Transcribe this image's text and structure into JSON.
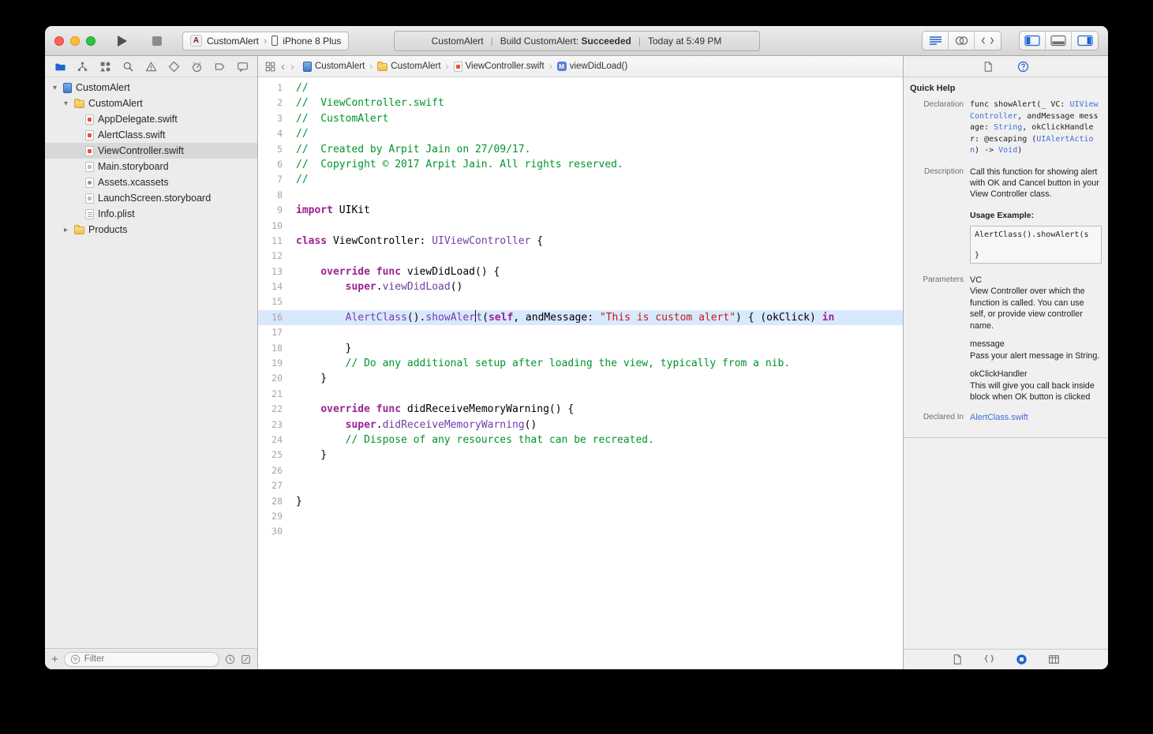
{
  "colors": {
    "accent": "#1B66D2",
    "keyword": "#9B2393",
    "type": "#703DAA",
    "string": "#C41A16",
    "comment": "#00942A",
    "link": "#3E6FD6",
    "current_line_band": "#D9E9FD"
  },
  "toolbar": {
    "app_icon_glyph": "A",
    "scheme": "CustomAlert",
    "scheme_chevron": "›",
    "device": "iPhone 8 Plus",
    "status": {
      "project": "CustomAlert",
      "separator": "|",
      "action": "Build CustomAlert:",
      "result": "Succeeded",
      "time": "Today at 5:49 PM"
    },
    "editor_modes": [
      "standard-editor",
      "assistant-editor",
      "version-editor"
    ],
    "active_editor_mode": "standard-editor",
    "panel_toggles": [
      {
        "id": "navigator-panel",
        "active": true
      },
      {
        "id": "debug-panel",
        "active": false
      },
      {
        "id": "inspector-panel",
        "active": true
      }
    ]
  },
  "navigator": {
    "tabs": [
      "project",
      "source-control",
      "symbols",
      "find",
      "issues",
      "tests",
      "debug",
      "breakpoints",
      "reports"
    ],
    "active_tab": "project",
    "tree": [
      {
        "label": "CustomAlert",
        "icon": "project",
        "level": 0,
        "disclosure": "open"
      },
      {
        "label": "CustomAlert",
        "icon": "folder",
        "level": 1,
        "disclosure": "open"
      },
      {
        "label": "AppDelegate.swift",
        "icon": "swift",
        "level": 2
      },
      {
        "label": "AlertClass.swift",
        "icon": "swift",
        "level": 2
      },
      {
        "label": "ViewController.swift",
        "icon": "swift",
        "level": 2,
        "selected": true
      },
      {
        "label": "Main.storyboard",
        "icon": "storyboard",
        "level": 2
      },
      {
        "label": "Assets.xcassets",
        "icon": "assets",
        "level": 2
      },
      {
        "label": "LaunchScreen.storyboard",
        "icon": "storyboard",
        "level": 2
      },
      {
        "label": "Info.plist",
        "icon": "plist",
        "level": 2
      },
      {
        "label": "Products",
        "icon": "folder",
        "level": 1,
        "disclosure": "closed"
      }
    ],
    "filter": {
      "placeholder": "Filter"
    }
  },
  "jumpbar": {
    "crumbs": [
      {
        "label": "CustomAlert",
        "icon": "file-blue"
      },
      {
        "label": "CustomAlert",
        "icon": "folder"
      },
      {
        "label": "ViewController.swift",
        "icon": "swift"
      },
      {
        "label": "viewDidLoad()",
        "icon": "method-badge"
      }
    ]
  },
  "editor": {
    "current_line": 16,
    "lines": [
      {
        "n": 1,
        "seg": [
          [
            "cm",
            "//"
          ]
        ]
      },
      {
        "n": 2,
        "seg": [
          [
            "cm",
            "//  ViewController.swift"
          ]
        ]
      },
      {
        "n": 3,
        "seg": [
          [
            "cm",
            "//  CustomAlert"
          ]
        ]
      },
      {
        "n": 4,
        "seg": [
          [
            "cm",
            "//"
          ]
        ]
      },
      {
        "n": 5,
        "seg": [
          [
            "cm",
            "//  Created by Arpit Jain on 27/09/17."
          ]
        ]
      },
      {
        "n": 6,
        "seg": [
          [
            "cm",
            "//  Copyright © 2017 Arpit Jain. All rights reserved."
          ]
        ]
      },
      {
        "n": 7,
        "seg": [
          [
            "cm",
            "//"
          ]
        ]
      },
      {
        "n": 8,
        "seg": []
      },
      {
        "n": 9,
        "seg": [
          [
            "kw",
            "import"
          ],
          [
            "pl",
            " UIKit"
          ]
        ]
      },
      {
        "n": 10,
        "seg": []
      },
      {
        "n": 11,
        "seg": [
          [
            "kw",
            "class"
          ],
          [
            "pl",
            " ViewController: "
          ],
          [
            "ty",
            "UIViewController"
          ],
          [
            "pl",
            " {"
          ]
        ]
      },
      {
        "n": 12,
        "seg": []
      },
      {
        "n": 13,
        "seg": [
          [
            "pl",
            "    "
          ],
          [
            "kw",
            "override"
          ],
          [
            "pl",
            " "
          ],
          [
            "kw",
            "func"
          ],
          [
            "pl",
            " viewDidLoad() {"
          ]
        ]
      },
      {
        "n": 14,
        "seg": [
          [
            "pl",
            "        "
          ],
          [
            "kw",
            "super"
          ],
          [
            "pl",
            "."
          ],
          [
            "ty",
            "viewDidLoad"
          ],
          [
            "pl",
            "()"
          ]
        ]
      },
      {
        "n": 15,
        "seg": []
      },
      {
        "n": 16,
        "seg": [
          [
            "pl",
            "        "
          ],
          [
            "ty",
            "AlertClass"
          ],
          [
            "pl",
            "()."
          ],
          [
            "ty",
            "showAler"
          ],
          [
            "caret",
            ""
          ],
          [
            "ty",
            "t"
          ],
          [
            "pl",
            "("
          ],
          [
            "kw",
            "self"
          ],
          [
            "pl",
            ", andMessage: "
          ],
          [
            "st",
            "\"This is custom alert\""
          ],
          [
            "pl",
            ") { (okClick) "
          ],
          [
            "kw",
            "in"
          ]
        ]
      },
      {
        "n": 17,
        "seg": []
      },
      {
        "n": 18,
        "seg": [
          [
            "pl",
            "        }"
          ]
        ]
      },
      {
        "n": 19,
        "seg": [
          [
            "pl",
            "        "
          ],
          [
            "cm",
            "// Do any additional setup after loading the view, typically from a nib."
          ]
        ]
      },
      {
        "n": 20,
        "seg": [
          [
            "pl",
            "    }"
          ]
        ]
      },
      {
        "n": 21,
        "seg": []
      },
      {
        "n": 22,
        "seg": [
          [
            "pl",
            "    "
          ],
          [
            "kw",
            "override"
          ],
          [
            "pl",
            " "
          ],
          [
            "kw",
            "func"
          ],
          [
            "pl",
            " didReceiveMemoryWarning() {"
          ]
        ]
      },
      {
        "n": 23,
        "seg": [
          [
            "pl",
            "        "
          ],
          [
            "kw",
            "super"
          ],
          [
            "pl",
            "."
          ],
          [
            "ty",
            "didReceiveMemoryWarning"
          ],
          [
            "pl",
            "()"
          ]
        ]
      },
      {
        "n": 24,
        "seg": [
          [
            "pl",
            "        "
          ],
          [
            "cm",
            "// Dispose of any resources that can be recreated."
          ]
        ]
      },
      {
        "n": 25,
        "seg": [
          [
            "pl",
            "    }"
          ]
        ]
      },
      {
        "n": 26,
        "seg": []
      },
      {
        "n": 27,
        "seg": []
      },
      {
        "n": 28,
        "seg": [
          [
            "pl",
            "}"
          ]
        ]
      },
      {
        "n": 29,
        "seg": []
      },
      {
        "n": 30,
        "seg": []
      }
    ]
  },
  "inspector": {
    "tabs": [
      "file-inspector",
      "quick-help"
    ],
    "active_tab": "quick-help",
    "title": "Quick Help",
    "declaration_label": "Declaration",
    "declaration": [
      [
        "pl",
        "func showAlert(_ VC: "
      ],
      [
        "lk",
        "UIViewController"
      ],
      [
        "pl",
        ", andMessage message: "
      ],
      [
        "lk",
        "String"
      ],
      [
        "pl",
        ", okClickHandler: @escaping ("
      ],
      [
        "lk",
        "UIAlertAction"
      ],
      [
        "pl",
        ") -> "
      ],
      [
        "lk",
        "Void"
      ],
      [
        "pl",
        ")"
      ]
    ],
    "description_label": "Description",
    "description": "Call this function for showing alert with OK and Cancel button in your View Controller class.",
    "usage_heading": "Usage Example:",
    "usage_lines": [
      "AlertClass().showAlert(s",
      "",
      "}"
    ],
    "parameters_label": "Parameters",
    "parameters": [
      {
        "name": "VC",
        "desc": "View Controller over which the function is called. You can use self, or provide view controller name."
      },
      {
        "name": "message",
        "desc": "Pass your alert message in String."
      },
      {
        "name": "okClickHandler",
        "desc": "This will give you call back inside block when OK button is clicked"
      }
    ],
    "declared_in_label": "Declared In",
    "declared_in": "AlertClass.swift",
    "library_tabs": [
      "file-template-library",
      "snippet-library",
      "object-library",
      "media-library"
    ],
    "active_library_tab": "object-library"
  }
}
